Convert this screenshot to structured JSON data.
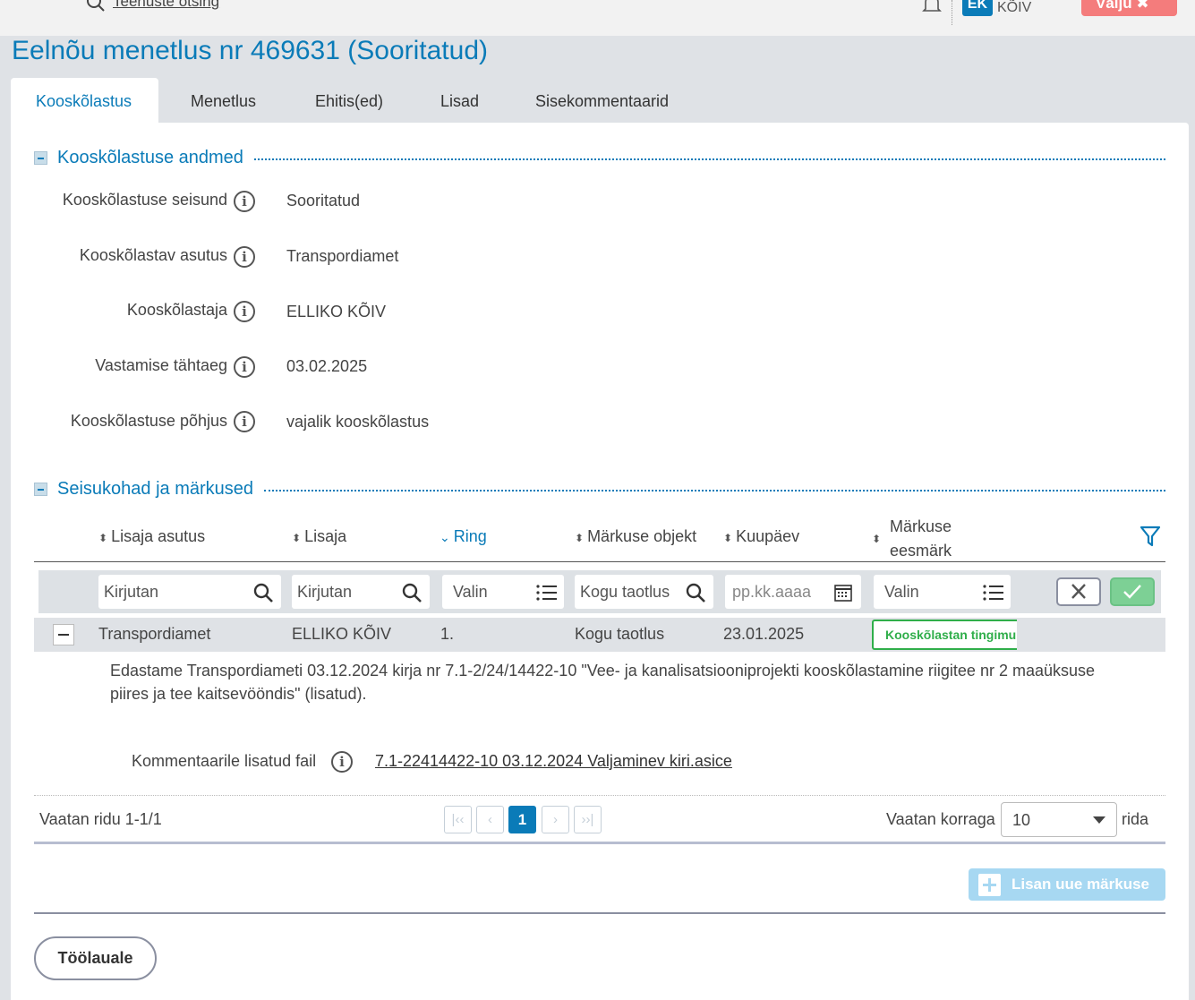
{
  "header": {
    "search_label": "Teenuste otsing",
    "user_initials": "EK",
    "user_name": "KÕIV",
    "exit_label": "Välju"
  },
  "page_title": "Eelnõu menetlus nr 469631 (Sooritatud)",
  "tabs": [
    {
      "label": "Kooskõlastus",
      "active": true
    },
    {
      "label": "Menetlus"
    },
    {
      "label": "Ehitis(ed)"
    },
    {
      "label": "Lisad"
    },
    {
      "label": "Sisekommentaarid"
    }
  ],
  "section1": {
    "title": "Kooskõlastuse andmed",
    "fields": [
      {
        "label": "Kooskõlastuse seisund",
        "value": "Sooritatud"
      },
      {
        "label": "Kooskõlastav asutus",
        "value": "Transpordiamet"
      },
      {
        "label": "Kooskõlastaja",
        "value": "ELLIKO KÕIV"
      },
      {
        "label": "Vastamise tähtaeg",
        "value": "03.02.2025"
      },
      {
        "label": "Kooskõlastuse põhjus",
        "value": "vajalik kooskõlastus"
      }
    ]
  },
  "section2": {
    "title": "Seisukohad ja märkused",
    "columns": [
      {
        "label": "Lisaja asutus"
      },
      {
        "label": "Lisaja"
      },
      {
        "label": "Ring",
        "sorted": true
      },
      {
        "label": "Märkuse objekt"
      },
      {
        "label": "Kuupäev"
      },
      {
        "label_line1": "Märkuse",
        "label_line2": "eesmärk"
      }
    ],
    "filters": {
      "lisaja_asutus": "Kirjutan",
      "lisaja": "Kirjutan",
      "ring": "Valin",
      "objekt": "Kogu taotlus",
      "kuupaev_placeholder": "pp.kk.aaaa",
      "eesmark": "Valin"
    },
    "row": {
      "asutus": "Transpordiamet",
      "lisaja": "ELLIKO KÕIV",
      "ring": "1.",
      "objekt": "Kogu taotlus",
      "kuupaev": "23.01.2025",
      "eesmark": "Kooskõlastan tingimu"
    },
    "description": "Edastame Transpordiameti  03.12.2024 kirja nr 7.1-2/24/14422-10 \"Vee- ja kanalisatsiooniprojekti kooskõlastamine riigitee nr 2 maaüksuse piires ja tee kaitsevööndis\" (lisatud).",
    "attachment_label": "Kommentaarile lisatud fail",
    "attachment_file": "7.1-22414422-10 03.12.2024 Valjaminev kiri.asice",
    "pager": {
      "summary": "Vaatan ridu 1-1/1",
      "current_page": "1",
      "per_page_label": "Vaatan korraga",
      "per_page_value": "10",
      "per_page_suffix": "rida"
    },
    "add_button": "Lisan uue märkuse"
  },
  "footer": {
    "desk_button": "Töölauale"
  }
}
